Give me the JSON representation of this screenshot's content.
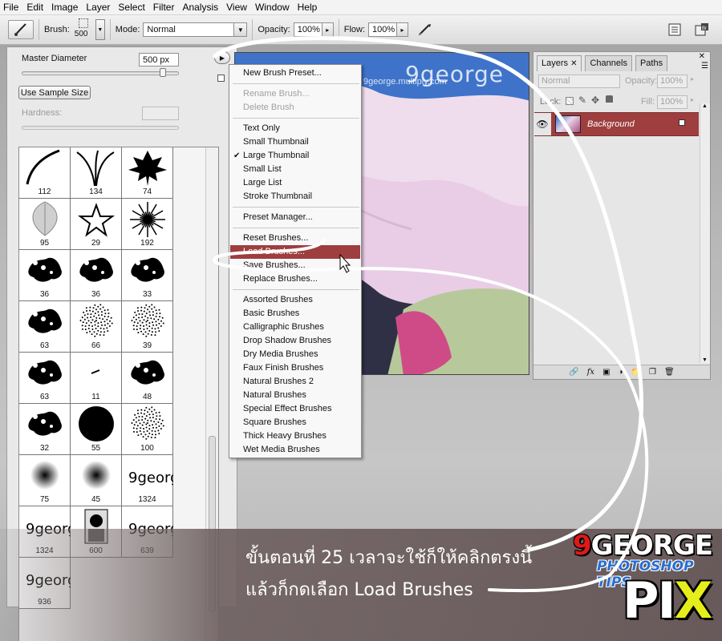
{
  "menubar": [
    "File",
    "Edit",
    "Image",
    "Layer",
    "Select",
    "Filter",
    "Analysis",
    "View",
    "Window",
    "Help"
  ],
  "options": {
    "brush_label": "Brush:",
    "brush_size": "500",
    "mode_label": "Mode:",
    "mode_value": "Normal",
    "opacity_label": "Opacity:",
    "opacity_value": "100%",
    "flow_label": "Flow:",
    "flow_value": "100%"
  },
  "brush_panel": {
    "master_diameter_label": "Master Diameter",
    "master_diameter_value": "500 px",
    "sample_size_button": "Use Sample Size",
    "hardness_label": "Hardness:",
    "presets": [
      {
        "size": "112",
        "shape": "stroke-curve"
      },
      {
        "size": "134",
        "shape": "grass"
      },
      {
        "size": "74",
        "shape": "maple-leaf"
      },
      {
        "size": "95",
        "shape": "leaf"
      },
      {
        "size": "29",
        "shape": "star"
      },
      {
        "size": "192",
        "shape": "starburst"
      },
      {
        "size": "36",
        "shape": "splatter"
      },
      {
        "size": "36",
        "shape": "splatter"
      },
      {
        "size": "33",
        "shape": "splatter"
      },
      {
        "size": "63",
        "shape": "splatter"
      },
      {
        "size": "66",
        "shape": "spray"
      },
      {
        "size": "39",
        "shape": "spray"
      },
      {
        "size": "63",
        "shape": "splatter"
      },
      {
        "size": "11",
        "shape": "dash"
      },
      {
        "size": "48",
        "shape": "splatter"
      },
      {
        "size": "32",
        "shape": "splatter"
      },
      {
        "size": "55",
        "shape": "hard-round"
      },
      {
        "size": "100",
        "shape": "spray"
      },
      {
        "size": "75",
        "shape": "soft-round"
      },
      {
        "size": "45",
        "shape": "soft-round"
      },
      {
        "size": "1324",
        "shape": "logo"
      },
      {
        "size": "1324",
        "shape": "logo"
      },
      {
        "size": "600",
        "shape": "portrait"
      },
      {
        "size": "639",
        "shape": "logo"
      },
      {
        "size": "936",
        "shape": "logo"
      }
    ]
  },
  "document": {
    "watermark": "9george",
    "watermark_url": "9george.multiply.com"
  },
  "preset_menu": [
    {
      "label": "New Brush Preset...",
      "state": "normal"
    },
    {
      "sep": true
    },
    {
      "label": "Rename Brush...",
      "state": "disabled"
    },
    {
      "label": "Delete Brush",
      "state": "disabled"
    },
    {
      "sep": true
    },
    {
      "label": "Text Only",
      "state": "normal"
    },
    {
      "label": "Small Thumbnail",
      "state": "normal"
    },
    {
      "label": "Large Thumbnail",
      "state": "checked"
    },
    {
      "label": "Small List",
      "state": "normal"
    },
    {
      "label": "Large List",
      "state": "normal"
    },
    {
      "label": "Stroke Thumbnail",
      "state": "normal"
    },
    {
      "sep": true
    },
    {
      "label": "Preset Manager...",
      "state": "normal"
    },
    {
      "sep": true
    },
    {
      "label": "Reset Brushes...",
      "state": "normal"
    },
    {
      "label": "Load Brushes...",
      "state": "active"
    },
    {
      "label": "Save Brushes...",
      "state": "normal"
    },
    {
      "label": "Replace Brushes...",
      "state": "normal"
    },
    {
      "sep": true
    },
    {
      "label": "Assorted Brushes",
      "state": "normal"
    },
    {
      "label": "Basic Brushes",
      "state": "normal"
    },
    {
      "label": "Calligraphic Brushes",
      "state": "normal"
    },
    {
      "label": "Drop Shadow Brushes",
      "state": "normal"
    },
    {
      "label": "Dry Media Brushes",
      "state": "normal"
    },
    {
      "label": "Faux Finish Brushes",
      "state": "normal"
    },
    {
      "label": "Natural Brushes 2",
      "state": "normal"
    },
    {
      "label": "Natural Brushes",
      "state": "normal"
    },
    {
      "label": "Special Effect Brushes",
      "state": "normal"
    },
    {
      "label": "Square Brushes",
      "state": "normal"
    },
    {
      "label": "Thick Heavy Brushes",
      "state": "normal"
    },
    {
      "label": "Wet Media Brushes",
      "state": "normal"
    }
  ],
  "layers_panel": {
    "tabs": [
      "Layers",
      "Channels",
      "Paths"
    ],
    "blend_mode": "Normal",
    "opacity_label": "Opacity:",
    "opacity_value": "100%",
    "lock_label": "Lock:",
    "fill_label": "Fill:",
    "fill_value": "100%",
    "layer_name": "Background"
  },
  "caption": {
    "line1": "ขั้นตอนที่ 25 เวลาจะใช้ก็ให้คลิกตรงนี้",
    "line2": "แล้วก็กดเลือก Load Brushes"
  },
  "logo": {
    "line1_nine": "9",
    "line1_rest": "GEORGE",
    "line2": "PHOTOSHOP TIPS",
    "line3_main": "PI",
    "line3_x": "X"
  },
  "colors": {
    "highlight": "#9e3e3e",
    "logo_red": "#e01818",
    "logo_blue": "#2a6fd1",
    "logo_yellow": "#e5ee1a"
  }
}
